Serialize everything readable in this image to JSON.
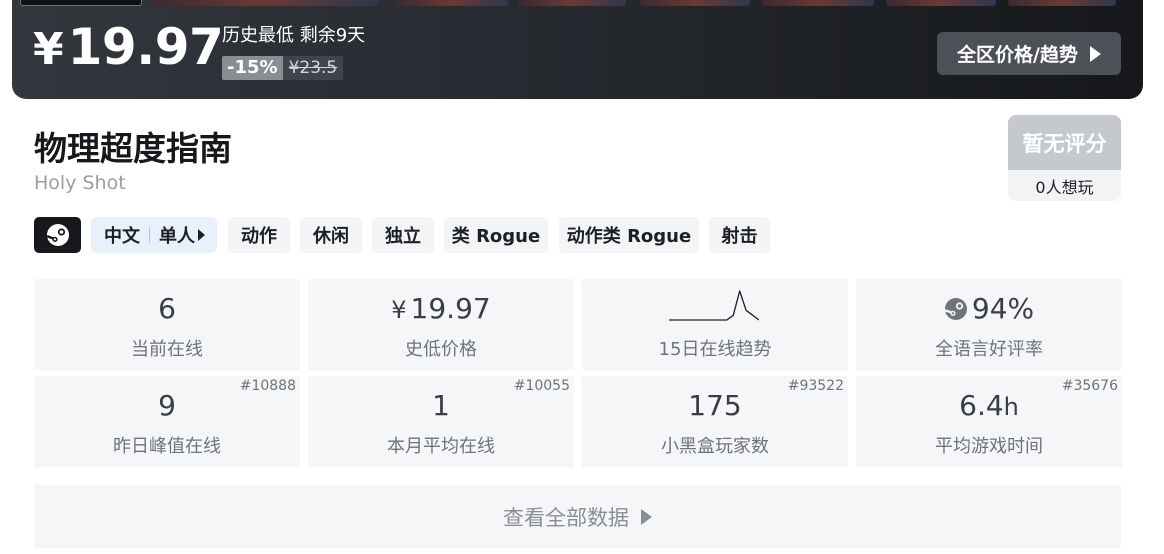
{
  "price_banner": {
    "currency_symbol": "¥",
    "current_price": "19.97",
    "history_note": "历史最低 剩余9天",
    "discount": "-15%",
    "original_price": "¥23.5",
    "region_button_label": "全区价格/趋势"
  },
  "game": {
    "title": "物理超度指南",
    "subtitle": "Holy Shot"
  },
  "rating": {
    "score_label": "暂无评分",
    "wishlist_label": "0人想玩"
  },
  "tags": {
    "language": "中文",
    "mode": "单人",
    "items": [
      "动作",
      "休闲",
      "独立",
      "类 Rogue",
      "动作类 Rogue",
      "射击"
    ]
  },
  "stats": {
    "current_online": {
      "value": "6",
      "label": "当前在线"
    },
    "lowest_price": {
      "currency": "¥",
      "value": "19.97",
      "label": "史低价格"
    },
    "trend": {
      "label": "15日在线趋势",
      "values": [
        0,
        0,
        0,
        0,
        0,
        0,
        0,
        0,
        0,
        0,
        1,
        6,
        2,
        1,
        0
      ]
    },
    "rating_pct": {
      "value": "94%",
      "label": "全语言好评率"
    },
    "peak_yesterday": {
      "value": "9",
      "label": "昨日峰值在线",
      "rank": "#10888"
    },
    "month_avg": {
      "value": "1",
      "label": "本月平均在线",
      "rank": "#10055"
    },
    "heybox_players": {
      "value": "175",
      "label": "小黑盒玩家数",
      "rank": "#93522"
    },
    "avg_playtime": {
      "value": "6.4",
      "unit": "h",
      "label": "平均游戏时间",
      "rank": "#35676"
    }
  },
  "all_data_label": "查看全部数据",
  "colors": {
    "banner_dark": "#24272c",
    "tag_bg": "#f3f4f6",
    "lang_tag_bg": "#e8f1fb",
    "stat_bg": "#f5f6f8",
    "rating_bg": "#c5c8cc"
  }
}
